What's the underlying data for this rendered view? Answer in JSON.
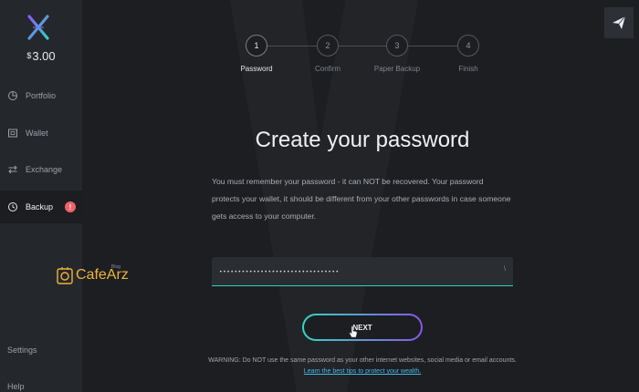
{
  "sidebar": {
    "balance_currency": "$",
    "balance_amount": "3.00",
    "items": [
      {
        "label": "Portfolio",
        "icon": "pie-chart-icon"
      },
      {
        "label": "Wallet",
        "icon": "wallet-icon"
      },
      {
        "label": "Exchange",
        "icon": "exchange-icon"
      },
      {
        "label": "Backup",
        "icon": "clock-icon",
        "badge": "!"
      }
    ],
    "settings_label": "Settings",
    "help_label": "Help"
  },
  "watermark": {
    "brand": "CafeArz",
    "small": "Blog"
  },
  "stepper": {
    "steps": [
      {
        "num": "1",
        "label": "Password"
      },
      {
        "num": "2",
        "label": "Confirm"
      },
      {
        "num": "3",
        "label": "Paper Backup"
      },
      {
        "num": "4",
        "label": "Finish"
      }
    ],
    "active_step": 1
  },
  "main": {
    "title": "Create your password",
    "description": "You must remember your password - it can NOT be recovered. Your password protects your wallet, it should be different from your other passwords in case someone gets access to your computer.",
    "password_value": "••••••••••••••••••••••••••••••••",
    "eye_glyph": "\\",
    "next_label": "NEXT",
    "warning_text": "WARNING: Do NOT use the same password as your other internet websites, social media or email accounts.",
    "warning_link": "Learn the best tips to protect your wealth."
  },
  "colors": {
    "accent_teal": "#2ed3b6",
    "accent_purple": "#8c55e6",
    "badge_red": "#f0626b",
    "link_blue": "#47b7e6",
    "watermark_gold": "#f0b43a"
  }
}
